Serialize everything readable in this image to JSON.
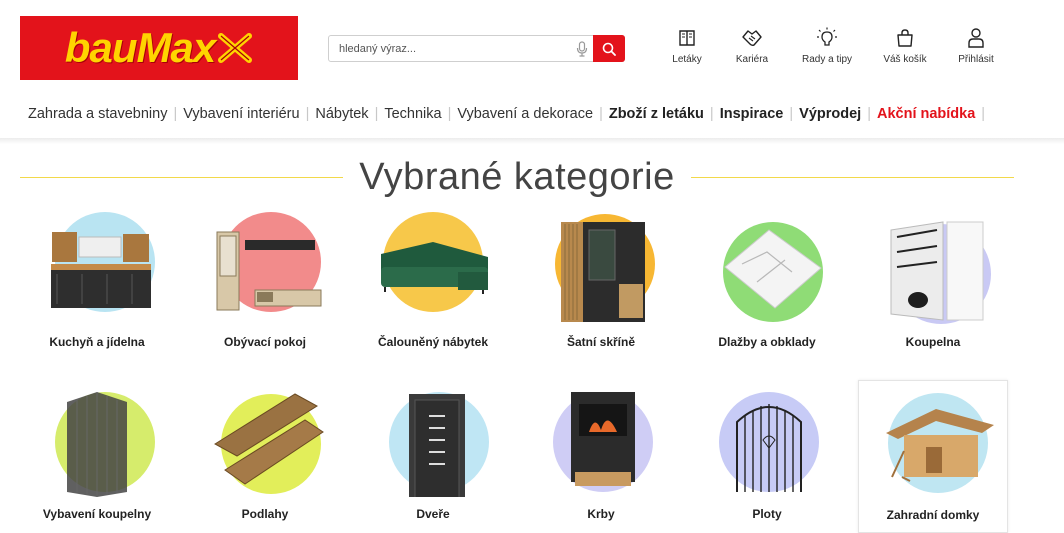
{
  "header": {
    "logo_text": "bauMax",
    "search_placeholder": "hledaný výraz...",
    "links": [
      {
        "label": "Letáky",
        "icon": "book-icon"
      },
      {
        "label": "Kariéra",
        "icon": "handshake-icon"
      },
      {
        "label": "Rady a tipy",
        "icon": "lightbulb-icon"
      },
      {
        "label": "Váš košík",
        "icon": "shopping-bag-icon"
      },
      {
        "label": "Přihlásit",
        "icon": "user-icon"
      }
    ]
  },
  "nav": {
    "items": [
      {
        "label": "Zahrada a stavebniny"
      },
      {
        "label": "Vybavení interiéru"
      },
      {
        "label": "Nábytek"
      },
      {
        "label": "Technika"
      },
      {
        "label": "Vybavení a dekorace"
      },
      {
        "label": "Zboží z letáku"
      },
      {
        "label": "Inspirace"
      },
      {
        "label": "Výprodej"
      },
      {
        "label": "Akční nabídka"
      }
    ]
  },
  "main": {
    "title": "Vybrané kategorie",
    "categories": [
      {
        "label": "Kuchyň a jídelna",
        "circle": "#b9e4f2"
      },
      {
        "label": "Obývací pokoj",
        "circle": "#f28b8b"
      },
      {
        "label": "Čalouněný nábytek",
        "circle": "#f7c84a"
      },
      {
        "label": "Šatní skříně",
        "circle": "#f7b733"
      },
      {
        "label": "Dlažby a obklady",
        "circle": "#8fdc76"
      },
      {
        "label": "Koupelna",
        "circle": "#c9c9f4"
      },
      {
        "label": "Vybavení koupelny",
        "circle": "#d6ec6c"
      },
      {
        "label": "Podlahy",
        "circle": "#e2ee5a"
      },
      {
        "label": "Dveře",
        "circle": "#bfe6f4"
      },
      {
        "label": "Krby",
        "circle": "#cfcdf5"
      },
      {
        "label": "Ploty",
        "circle": "#c7cbf6"
      },
      {
        "label": "Zahradní domky",
        "circle": "#bfe6f2"
      }
    ]
  },
  "colors": {
    "brand_red": "#e3131b",
    "brand_yellow": "#ffd400",
    "title_line": "#f2d94a"
  }
}
